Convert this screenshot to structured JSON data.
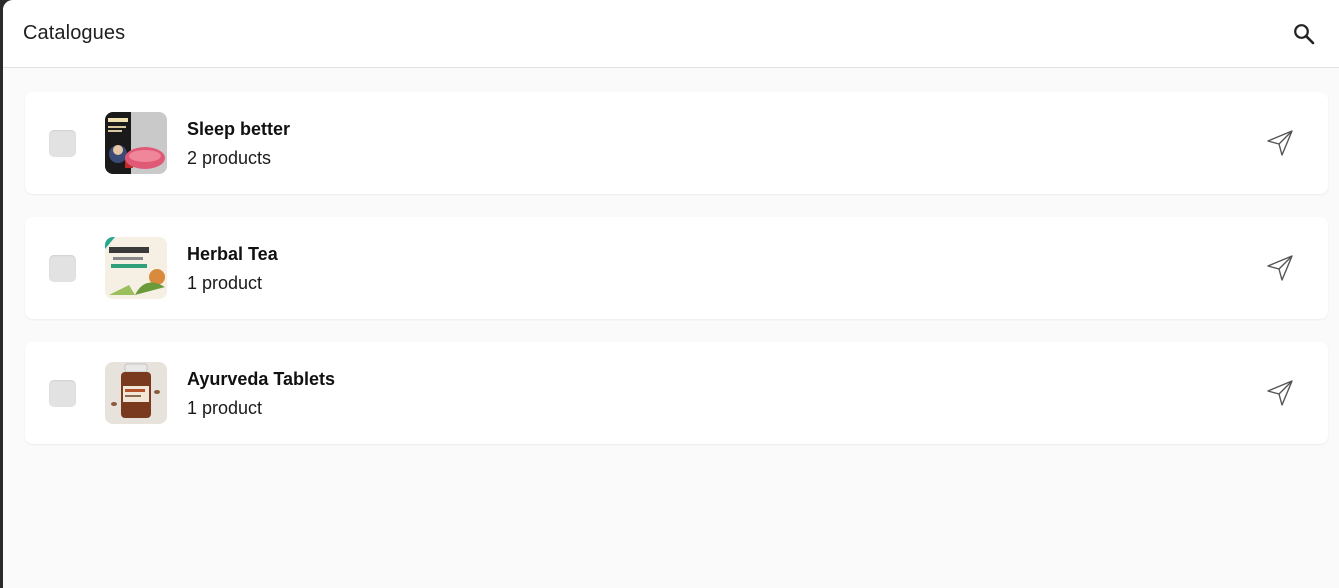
{
  "header": {
    "title": "Catalogues",
    "search_icon": "search-icon"
  },
  "catalogues": [
    {
      "name": "Sleep better",
      "count": "2 products",
      "thumb": "sleep-mask-product-image",
      "selected": false
    },
    {
      "name": "Herbal Tea",
      "count": "1 product",
      "thumb": "green-tea-box-image",
      "selected": false
    },
    {
      "name": "Ayurveda Tablets",
      "count": "1 product",
      "thumb": "supplement-bottle-image",
      "selected": false
    }
  ],
  "icons": {
    "share": "send-icon"
  },
  "colors": {
    "background": "#fafafa",
    "card": "#ffffff",
    "checkbox": "#e2e2e2",
    "text": "#111111"
  }
}
